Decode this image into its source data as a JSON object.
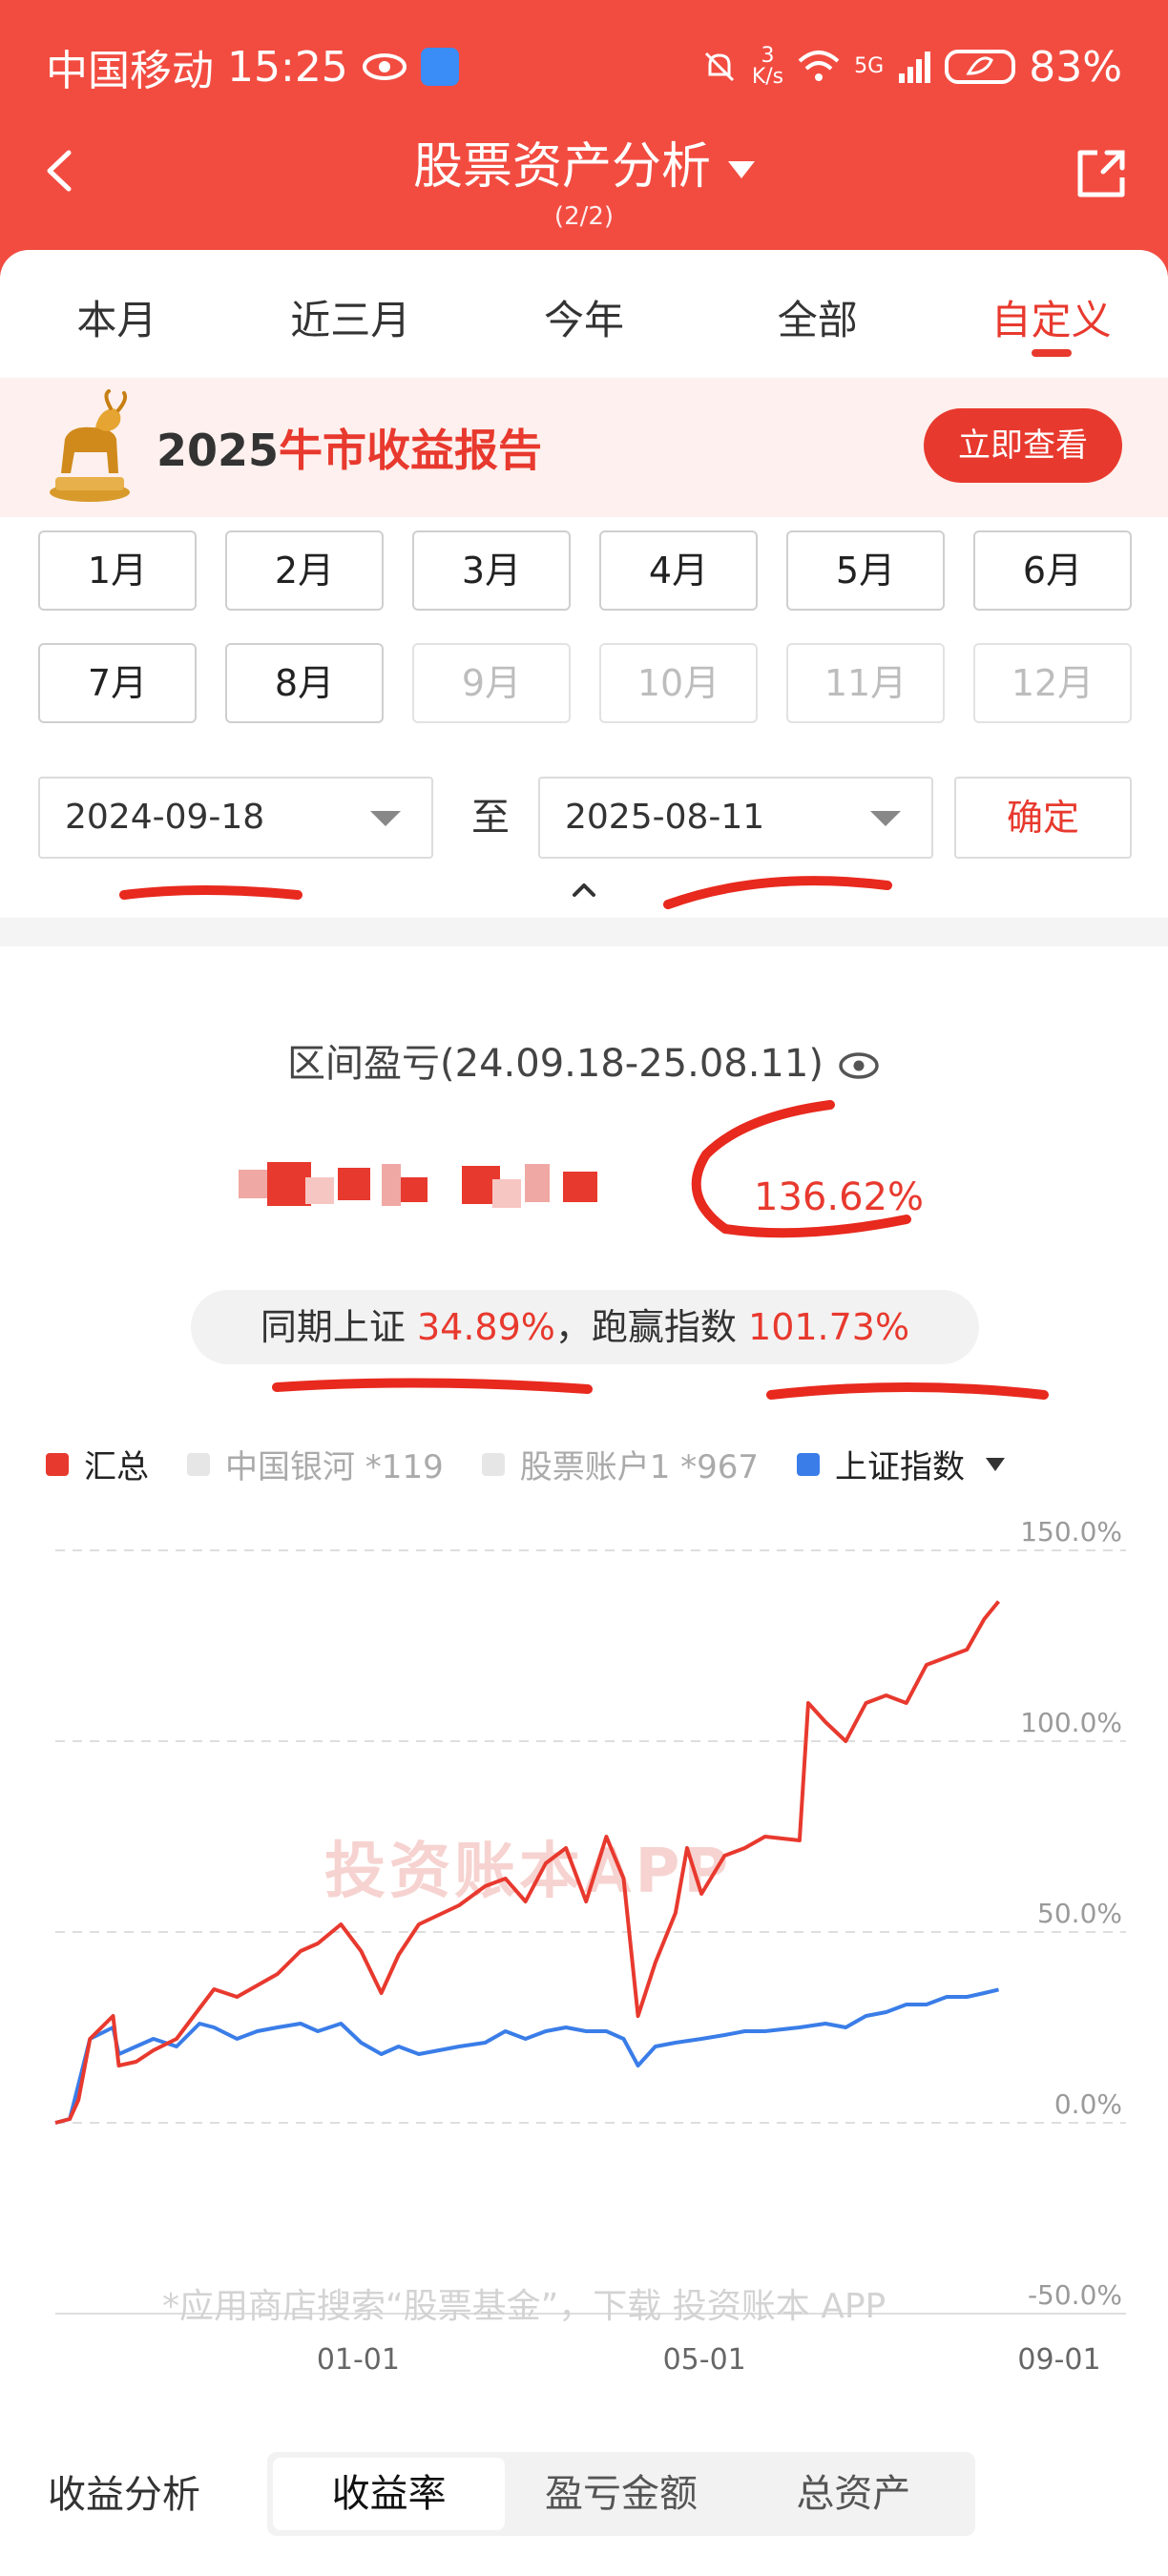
{
  "status_bar": {
    "carrier": "中国移动",
    "time": "15:25",
    "net_speed_top": "3",
    "net_speed_bottom": "K/s",
    "signal_label": "5G",
    "battery": "83%"
  },
  "header": {
    "title": "股票资产分析",
    "subtitle": "(2/2)"
  },
  "tabs": [
    {
      "label": "本月"
    },
    {
      "label": "近三月"
    },
    {
      "label": "今年"
    },
    {
      "label": "全部"
    },
    {
      "label": "自定义"
    }
  ],
  "banner": {
    "year": "2025",
    "text": "牛市收益报告",
    "button": "立即查看"
  },
  "months": [
    {
      "label": "1月"
    },
    {
      "label": "2月"
    },
    {
      "label": "3月"
    },
    {
      "label": "4月"
    },
    {
      "label": "5月"
    },
    {
      "label": "6月"
    },
    {
      "label": "7月"
    },
    {
      "label": "8月"
    },
    {
      "label": "9月"
    },
    {
      "label": "10月"
    },
    {
      "label": "11月"
    },
    {
      "label": "12月"
    }
  ],
  "range": {
    "start": "2024-09-18",
    "separator": "至",
    "end": "2025-08-11",
    "confirm": "确定"
  },
  "summary": {
    "period_label": "区间盈亏(24.09.18-25.08.11)",
    "return_pct": "136.62%",
    "compare_prefix": "同期上证",
    "compare_index_pct": "34.89%",
    "compare_mid": "，跑赢指数",
    "compare_excess_pct": "101.73%"
  },
  "legend": [
    {
      "label": "汇总",
      "color": "#e8392e",
      "active": true
    },
    {
      "label": "中国银河 *119",
      "color": "#e0e0e0",
      "active": false
    },
    {
      "label": "股票账户1 *967",
      "color": "#e0e0e0",
      "active": false
    },
    {
      "label": "上证指数",
      "color": "#3a7de8",
      "active": true
    }
  ],
  "chart_data": {
    "type": "line",
    "y_ticks": [
      "150.0%",
      "100.0%",
      "50.0%",
      "0.0%",
      "-50.0%"
    ],
    "x_ticks": [
      "01-01",
      "05-01",
      "09-01"
    ],
    "ylim": [
      -50,
      150
    ],
    "xlim": [
      "2024-09-18",
      "2025-09-01"
    ],
    "grid": true,
    "series": [
      {
        "name": "汇总",
        "color": "#e8392e",
        "points": [
          [
            "2024-09-18",
            0
          ],
          [
            "2024-09-23",
            1
          ],
          [
            "2024-09-26",
            6
          ],
          [
            "2024-09-30",
            22
          ],
          [
            "2024-10-08",
            28
          ],
          [
            "2024-10-10",
            15
          ],
          [
            "2024-10-16",
            16
          ],
          [
            "2024-10-22",
            19
          ],
          [
            "2024-10-30",
            22
          ],
          [
            "2024-11-07",
            30
          ],
          [
            "2024-11-12",
            35
          ],
          [
            "2024-11-20",
            33
          ],
          [
            "2024-11-27",
            36
          ],
          [
            "2024-12-04",
            39
          ],
          [
            "2024-12-12",
            45
          ],
          [
            "2024-12-18",
            47
          ],
          [
            "2024-12-26",
            52
          ],
          [
            "2025-01-02",
            45
          ],
          [
            "2025-01-09",
            34
          ],
          [
            "2025-01-15",
            44
          ],
          [
            "2025-01-22",
            52
          ],
          [
            "2025-02-05",
            57
          ],
          [
            "2025-02-14",
            62
          ],
          [
            "2025-02-21",
            64
          ],
          [
            "2025-02-28",
            58
          ],
          [
            "2025-03-07",
            68
          ],
          [
            "2025-03-14",
            72
          ],
          [
            "2025-03-21",
            58
          ],
          [
            "2025-03-28",
            75
          ],
          [
            "2025-04-03",
            64
          ],
          [
            "2025-04-08",
            28
          ],
          [
            "2025-04-14",
            42
          ],
          [
            "2025-04-21",
            55
          ],
          [
            "2025-04-25",
            72
          ],
          [
            "2025-04-30",
            60
          ],
          [
            "2025-05-08",
            70
          ],
          [
            "2025-05-15",
            72
          ],
          [
            "2025-05-22",
            75
          ],
          [
            "2025-06-03",
            74
          ],
          [
            "2025-06-06",
            110
          ],
          [
            "2025-06-12",
            105
          ],
          [
            "2025-06-19",
            100
          ],
          [
            "2025-06-26",
            110
          ],
          [
            "2025-07-03",
            112
          ],
          [
            "2025-07-10",
            110
          ],
          [
            "2025-07-17",
            120
          ],
          [
            "2025-07-24",
            122
          ],
          [
            "2025-07-31",
            124
          ],
          [
            "2025-08-06",
            132
          ],
          [
            "2025-08-11",
            136.62
          ]
        ]
      },
      {
        "name": "上证指数",
        "color": "#3a7de8",
        "points": [
          [
            "2024-09-18",
            0
          ],
          [
            "2024-09-23",
            1
          ],
          [
            "2024-09-26",
            10
          ],
          [
            "2024-09-30",
            22
          ],
          [
            "2024-10-08",
            25
          ],
          [
            "2024-10-10",
            18
          ],
          [
            "2024-10-16",
            20
          ],
          [
            "2024-10-22",
            22
          ],
          [
            "2024-10-30",
            20
          ],
          [
            "2024-11-07",
            26
          ],
          [
            "2024-11-12",
            25
          ],
          [
            "2024-11-20",
            22
          ],
          [
            "2024-11-27",
            24
          ],
          [
            "2024-12-04",
            25
          ],
          [
            "2024-12-12",
            26
          ],
          [
            "2024-12-18",
            24
          ],
          [
            "2024-12-26",
            26
          ],
          [
            "2025-01-02",
            21
          ],
          [
            "2025-01-09",
            18
          ],
          [
            "2025-01-15",
            20
          ],
          [
            "2025-01-22",
            18
          ],
          [
            "2025-02-05",
            20
          ],
          [
            "2025-02-14",
            21
          ],
          [
            "2025-02-21",
            24
          ],
          [
            "2025-02-28",
            22
          ],
          [
            "2025-03-07",
            24
          ],
          [
            "2025-03-14",
            25
          ],
          [
            "2025-03-21",
            24
          ],
          [
            "2025-03-28",
            24
          ],
          [
            "2025-04-03",
            22
          ],
          [
            "2025-04-08",
            15
          ],
          [
            "2025-04-14",
            20
          ],
          [
            "2025-04-21",
            21
          ],
          [
            "2025-04-30",
            22
          ],
          [
            "2025-05-08",
            23
          ],
          [
            "2025-05-15",
            24
          ],
          [
            "2025-05-22",
            24
          ],
          [
            "2025-06-03",
            25
          ],
          [
            "2025-06-12",
            26
          ],
          [
            "2025-06-19",
            25
          ],
          [
            "2025-06-26",
            28
          ],
          [
            "2025-07-03",
            29
          ],
          [
            "2025-07-10",
            31
          ],
          [
            "2025-07-17",
            31
          ],
          [
            "2025-07-24",
            33
          ],
          [
            "2025-07-31",
            33
          ],
          [
            "2025-08-06",
            34
          ],
          [
            "2025-08-11",
            34.89
          ]
        ]
      }
    ]
  },
  "watermark": "投资账本APP",
  "footnote": "*应用商店搜索“股票基金”，下载 投资账本 APP",
  "bottom": {
    "label": "收益分析",
    "tabs": [
      {
        "label": "收益率"
      },
      {
        "label": "盈亏金额"
      },
      {
        "label": "总资产"
      }
    ]
  }
}
